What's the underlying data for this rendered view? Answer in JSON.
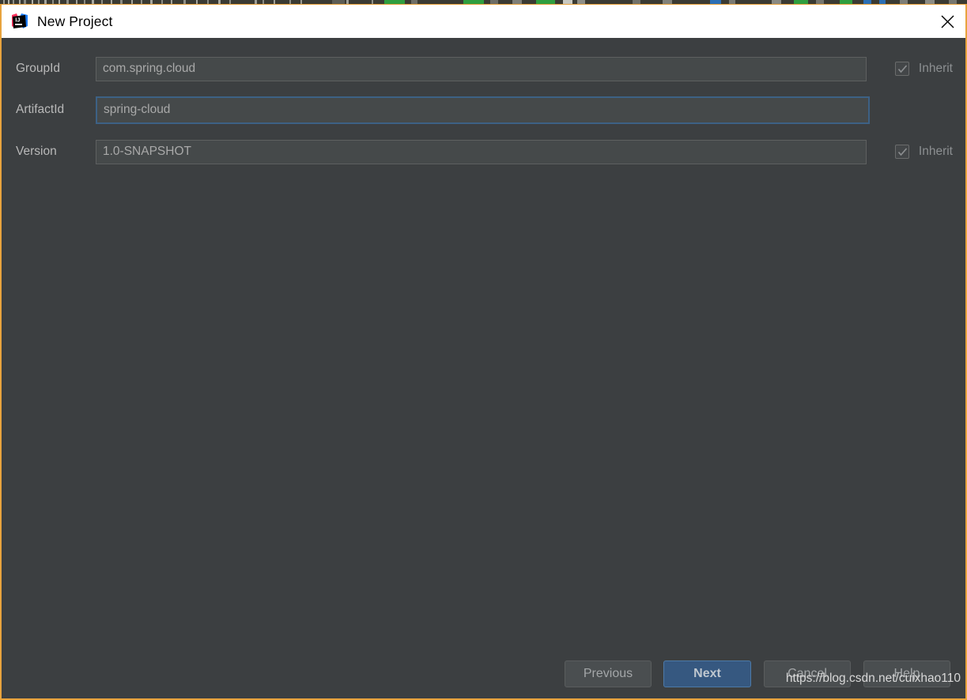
{
  "window": {
    "title": "New Project",
    "app_icon": "intellij-idea-logo-icon",
    "close_icon": "close-icon",
    "active_border_color": "#e8a33d",
    "titlebar_background": "#ffffff",
    "body_background": "#3c3f41"
  },
  "form": {
    "rows": [
      {
        "label": "GroupId",
        "value": "com.spring.cloud",
        "placeholder": "GroupId",
        "inherit": {
          "label": "Inherit",
          "checked": true,
          "enabled": false
        },
        "focused": false
      },
      {
        "label": "ArtifactId",
        "value": "spring-cloud",
        "placeholder": "ArtifactId",
        "inherit": null,
        "focused": true
      },
      {
        "label": "Version",
        "value": "1.0-SNAPSHOT",
        "placeholder": "Version",
        "inherit": {
          "label": "Inherit",
          "checked": true,
          "enabled": false
        },
        "focused": false
      }
    ],
    "focus_border_color": "#3d6185",
    "input_background": "#45494a"
  },
  "buttons": {
    "previous": "Previous",
    "next": "Next",
    "cancel": "Cancel",
    "help": "Help",
    "default_button": "Next",
    "default_button_color": "#365880"
  },
  "watermark": {
    "text": "https://blog.csdn.net/cuixhao110"
  }
}
